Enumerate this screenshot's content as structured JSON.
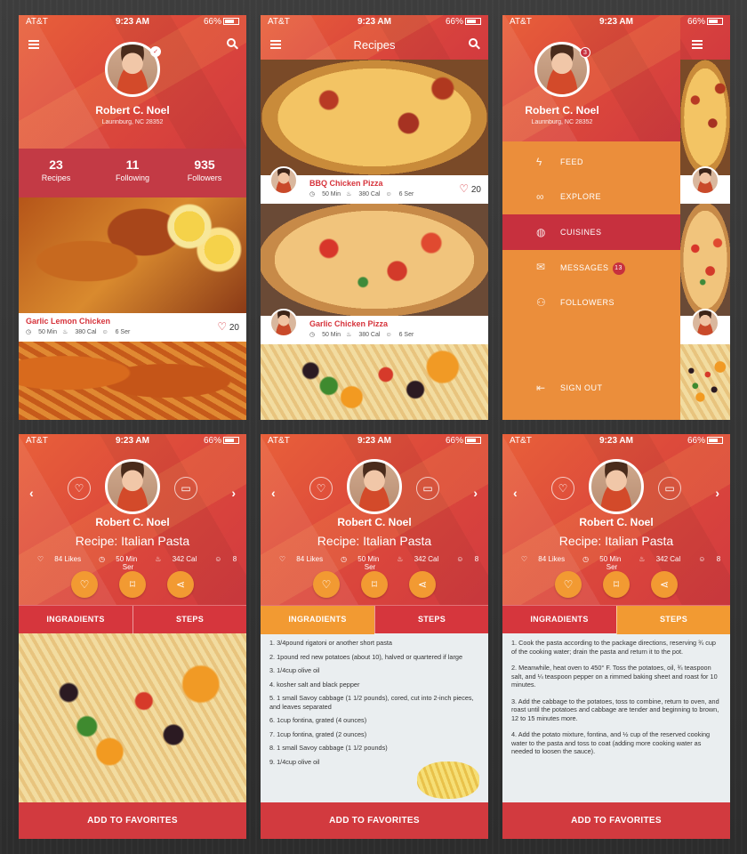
{
  "status": {
    "carrier": "AT&T",
    "time": "9:23 AM",
    "battery": "66%"
  },
  "profile": {
    "name": "Robert C. Noel",
    "location": "Laurinburg, NC 28352",
    "stats": [
      {
        "value": "23",
        "label": "Recipes"
      },
      {
        "value": "11",
        "label": "Following"
      },
      {
        "value": "935",
        "label": "Followers"
      }
    ]
  },
  "profile_card": {
    "title": "Garlic Lemon Chicken",
    "time": "50 Min",
    "cal": "380 Cal",
    "serves": "6 Ser",
    "likes": "20"
  },
  "recipes_screen": {
    "title": "Recipes",
    "cards": [
      {
        "title": "BBQ Chicken Pizza",
        "time": "50 Min",
        "cal": "380 Cal",
        "serves": "6 Ser",
        "likes": "20"
      },
      {
        "title": "Garlic Chicken Pizza",
        "time": "50 Min",
        "cal": "380 Cal",
        "serves": "6 Ser"
      }
    ]
  },
  "menu": {
    "badge": "3",
    "items": [
      {
        "label": "FEED",
        "icon": "bolt-icon"
      },
      {
        "label": "EXPLORE",
        "icon": "binoculars-icon"
      },
      {
        "label": "CUISINES",
        "icon": "globe-icon"
      },
      {
        "label": "MESSAGES",
        "icon": "envelope-icon",
        "count": "13"
      },
      {
        "label": "FOLLOWERS",
        "icon": "users-icon"
      }
    ],
    "signout": "SIGN OUT"
  },
  "detail": {
    "title": "Recipe: Italian Pasta",
    "likes": "84 Likes",
    "time": "50 Min",
    "cal": "342 Cal",
    "serves": "8 Ser",
    "tab_ing": "INGRADIENTS",
    "tab_steps": "STEPS",
    "fav": "ADD TO FAVORITES"
  },
  "ingredients": [
    "1. 3/4pound rigatoni or another short pasta",
    "2. 1pound red new potatoes (about 10), halved or quartered if large",
    "3. 1/4cup olive oil",
    "4. kosher salt and black pepper",
    "5. 1 small Savoy cabbage (1 1/2 pounds), cored, cut into 2-inch pieces, and leaves separated",
    "6. 1cup fontina, grated (4 ounces)",
    "7. 1cup fontina, grated (2 ounces)",
    "8. 1 small Savoy cabbage (1 1/2 pounds)",
    "9. 1/4cup olive oil"
  ],
  "steps": [
    "1. Cook the pasta according to the package directions, reserving ¾ cup of the cooking water; drain the pasta and return it to the pot.",
    "2. Meanwhile, heat oven to 450° F. Toss the potatoes, oil, ¾ teaspoon salt, and ¼ teaspoon pepper on a rimmed baking sheet and roast for 10 minutes.",
    "3. Add the cabbage to the potatoes, toss to combine, return to oven, and roast until the potatoes and cabbage are tender and beginning to brown, 12 to 15 minutes more.",
    "4. Add the potato mixture, fontina, and ½ cup of the reserved cooking water to the pasta and toss to coat (adding more cooking water as needed to loosen the sauce)."
  ]
}
